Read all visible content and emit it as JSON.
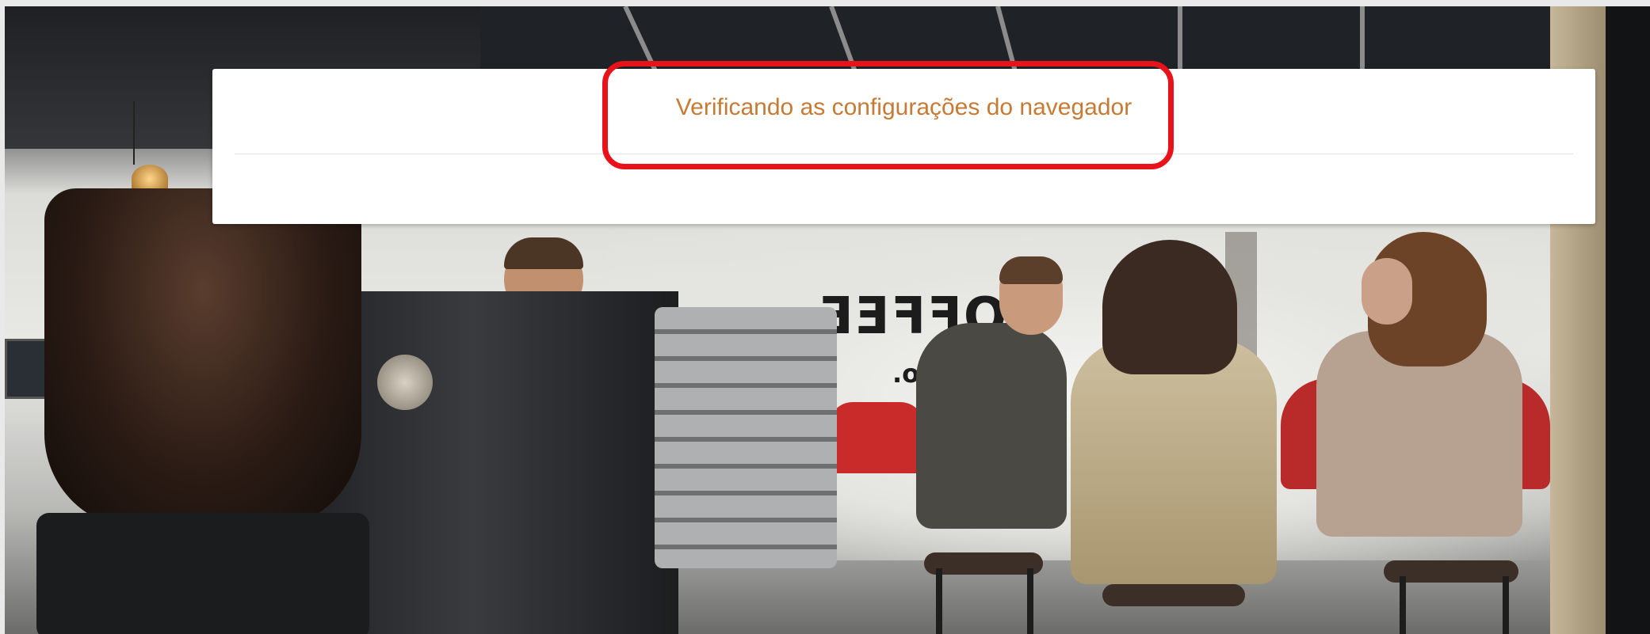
{
  "dialog": {
    "title": "Verificando as configurações do navegador"
  },
  "background": {
    "storefront_text": "COFFEE",
    "storefront_subtext": "co."
  },
  "colors": {
    "title_text": "#c77a34",
    "annotation_outline": "#e8121a",
    "dialog_background": "#ffffff"
  }
}
